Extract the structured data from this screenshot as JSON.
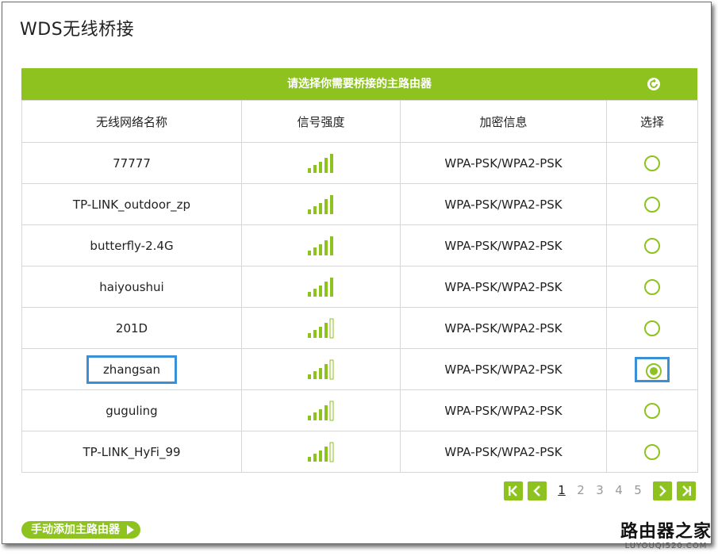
{
  "page": {
    "title": "WDS无线桥接"
  },
  "scan_table": {
    "header_title": "请选择你需要桥接的主路由器",
    "columns": [
      "无线网络名称",
      "信号强度",
      "加密信息",
      "选择"
    ],
    "rows": [
      {
        "ssid": "77777",
        "signal": 5,
        "security": "WPA-PSK/WPA2-PSK",
        "selected": false
      },
      {
        "ssid": "TP-LINK_outdoor_zp",
        "signal": 5,
        "security": "WPA-PSK/WPA2-PSK",
        "selected": false
      },
      {
        "ssid": "butterfly-2.4G",
        "signal": 5,
        "security": "WPA-PSK/WPA2-PSK",
        "selected": false
      },
      {
        "ssid": "haiyoushui",
        "signal": 5,
        "security": "WPA-PSK/WPA2-PSK",
        "selected": false
      },
      {
        "ssid": "201D",
        "signal": 4,
        "security": "WPA-PSK/WPA2-PSK",
        "selected": false
      },
      {
        "ssid": "zhangsan",
        "signal": 4,
        "security": "WPA-PSK/WPA2-PSK",
        "selected": true
      },
      {
        "ssid": "guguling",
        "signal": 4,
        "security": "WPA-PSK/WPA2-PSK",
        "selected": false
      },
      {
        "ssid": "TP-LINK_HyFi_99",
        "signal": 4,
        "security": "WPA-PSK/WPA2-PSK",
        "selected": false
      }
    ]
  },
  "pagination": {
    "pages": [
      "1",
      "2",
      "3",
      "4",
      "5"
    ],
    "current": "1"
  },
  "manual_add": {
    "label": "手动添加主路由器"
  },
  "watermark": {
    "name": "路由器之家",
    "url": "LUYOUQI520.COM"
  },
  "colors": {
    "accent": "#8dc21f",
    "highlight": "#3a8fd6"
  }
}
